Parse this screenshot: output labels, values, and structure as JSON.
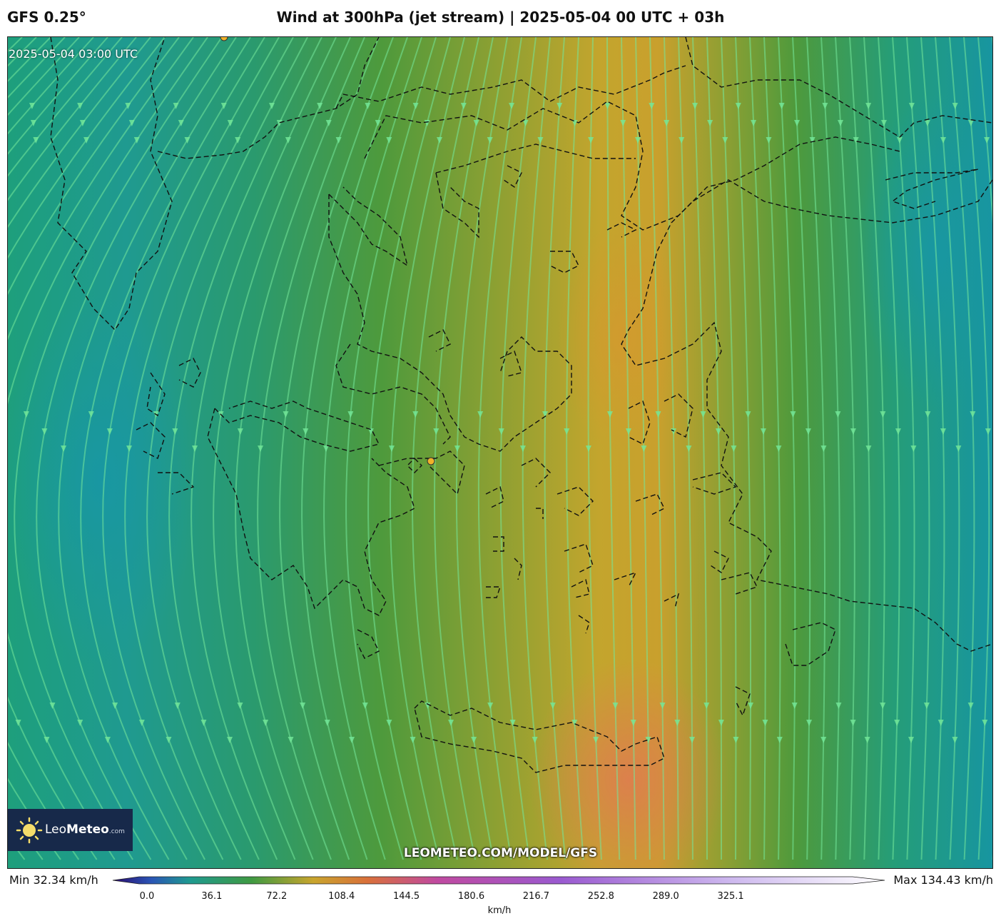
{
  "header": {
    "model": "GFS 0.25°",
    "title": "Wind at 300hPa (jet stream) | 2025-05-04 00 UTC + 03h"
  },
  "map": {
    "valid_time": "2025-05-04 03:00 UTC",
    "footer_url": "LEOMETEO.COM/MODEL/GFS",
    "colors": {
      "low": "#1f9a90",
      "mid": "#4a9a3a",
      "high": "#cfa52a",
      "peak": "#d97a4a",
      "streamline": "#74e89a",
      "coast": "#111111",
      "marker": "#f0b22a"
    }
  },
  "logo": {
    "icon": "sun-icon",
    "name_light": "Leo",
    "name_bold": "Meteo",
    "domain": ".com"
  },
  "colorbar": {
    "min_label": "Min 32.34 km/h",
    "max_label": "Max 134.43 km/h",
    "ticks": [
      "0.0",
      "36.1",
      "72.2",
      "108.4",
      "144.5",
      "180.6",
      "216.7",
      "252.8",
      "289.0",
      "325.1"
    ],
    "unit": "km/h"
  }
}
